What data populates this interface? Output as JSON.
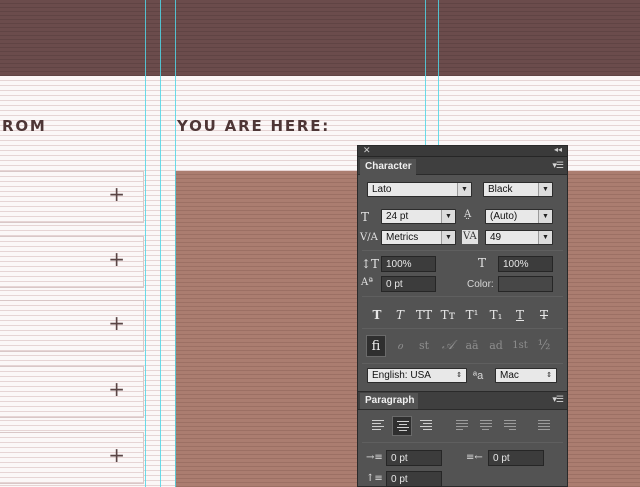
{
  "canvas": {
    "heading_left": "ROM",
    "heading_main": "YOU ARE HERE:",
    "accordion": [
      {
        "icon": "plus-icon",
        "glyph": "+"
      },
      {
        "icon": "plus-icon",
        "glyph": "+"
      },
      {
        "icon": "plus-icon",
        "glyph": "+"
      },
      {
        "icon": "plus-icon",
        "glyph": "+"
      },
      {
        "icon": "plus-icon",
        "glyph": "+"
      }
    ],
    "colors": {
      "header": "#6b4c4c",
      "hero": "#ab7d70",
      "guide": "#4fd6e6"
    }
  },
  "panel": {
    "close_glyph": "✕",
    "collapse_glyph": "◂◂",
    "menu_glyph": "▾☰",
    "character": {
      "tab": "Character",
      "font_family": "Lato",
      "font_style": "Black",
      "font_size": "24 pt",
      "leading": "(Auto)",
      "kerning": "Metrics",
      "tracking": "49",
      "vertical_scale": "100%",
      "horizontal_scale": "100%",
      "baseline_shift": "0 pt",
      "color_label": "Color:",
      "type_buttons": [
        "T",
        "T",
        "TT",
        "Tт",
        "T¹",
        "T₁",
        "T",
        "T"
      ],
      "opentype_buttons": [
        "ﬁ",
        "ℴ",
        "st",
        "𝒜",
        "aā",
        "ad",
        "1st",
        "½"
      ],
      "language": "English: USA",
      "aa_glyph": "ªa",
      "antialias": "Mac"
    },
    "paragraph": {
      "tab": "Paragraph",
      "indent_left": "0 pt",
      "indent_right": "0 pt",
      "space_before": "0 pt"
    }
  }
}
